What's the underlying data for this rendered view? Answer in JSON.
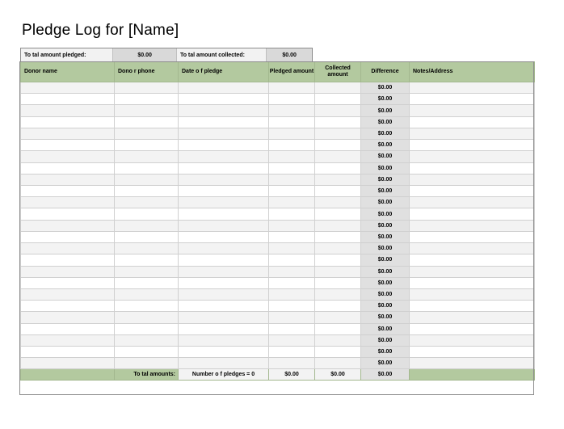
{
  "title": "Pledge Log for [Name]",
  "summary": {
    "total_pledged_label": "To tal amount pledged:",
    "total_pledged_value": "$0.00",
    "total_collected_label": "To tal amount collected:",
    "total_collected_value": "$0.00"
  },
  "columns": {
    "donor_name": "Donor name",
    "donor_phone": "Dono r phone",
    "date_of_pledge": "Date o f pledge",
    "pledged_amount": "Pledged amount",
    "collected_amount": "Collected amount",
    "difference": "Difference",
    "notes_address": "Notes/Address"
  },
  "rows": [
    {
      "difference": "$0.00"
    },
    {
      "difference": "$0.00"
    },
    {
      "difference": "$0.00"
    },
    {
      "difference": "$0.00"
    },
    {
      "difference": "$0.00"
    },
    {
      "difference": "$0.00"
    },
    {
      "difference": "$0.00"
    },
    {
      "difference": "$0.00"
    },
    {
      "difference": "$0.00"
    },
    {
      "difference": "$0.00"
    },
    {
      "difference": "$0.00"
    },
    {
      "difference": "$0.00"
    },
    {
      "difference": "$0.00"
    },
    {
      "difference": "$0.00"
    },
    {
      "difference": "$0.00"
    },
    {
      "difference": "$0.00"
    },
    {
      "difference": "$0.00"
    },
    {
      "difference": "$0.00"
    },
    {
      "difference": "$0.00"
    },
    {
      "difference": "$0.00"
    },
    {
      "difference": "$0.00"
    },
    {
      "difference": "$0.00"
    },
    {
      "difference": "$0.00"
    },
    {
      "difference": "$0.00"
    },
    {
      "difference": "$0.00"
    }
  ],
  "totals": {
    "label": "To tal amounts:",
    "count": "Number o f pledges = 0",
    "pledged": "$0.00",
    "collected": "$0.00",
    "difference": "$0.00"
  },
  "colors": {
    "header_green": "#b3c99f",
    "band_gray": "#f3f3f3",
    "difference_gray": "#e0e0e0"
  }
}
